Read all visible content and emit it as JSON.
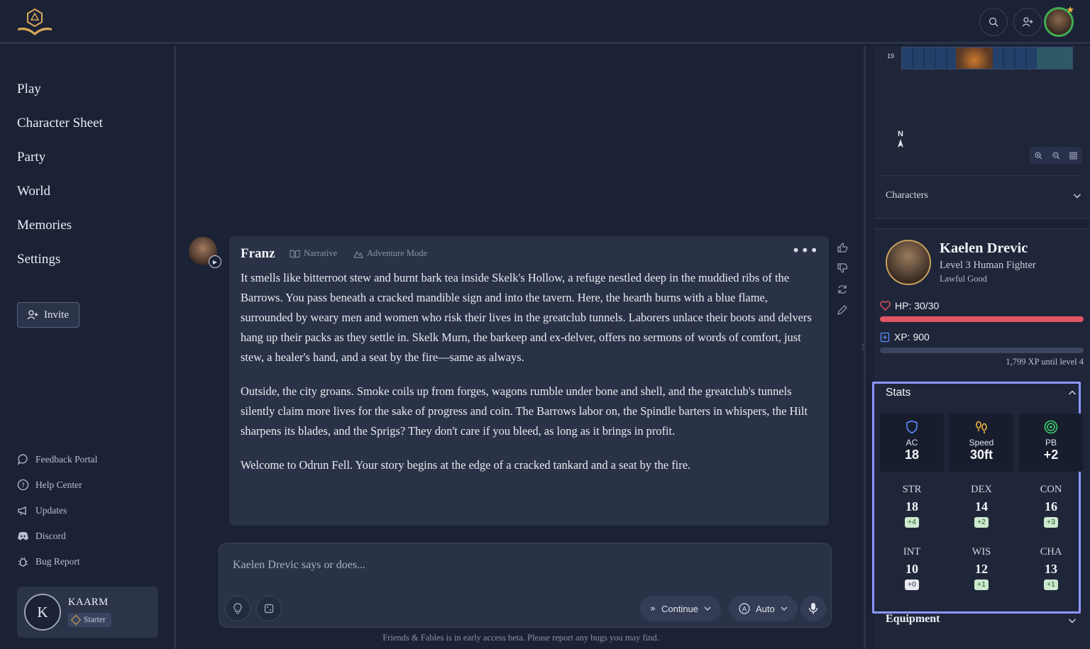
{
  "nav": {
    "items": [
      "Play",
      "Character Sheet",
      "Party",
      "World",
      "Memories",
      "Settings"
    ],
    "invite_label": "Invite",
    "links": [
      "Feedback Portal",
      "Help Center",
      "Updates",
      "Discord",
      "Bug Report"
    ]
  },
  "user": {
    "initial": "K",
    "name": "KAARM",
    "tier": "Starter"
  },
  "message": {
    "author": "Franz",
    "tag_narrative": "Narrative",
    "tag_mode": "Adventure Mode",
    "more": "•••",
    "paragraphs": [
      "It smells like bitterroot stew and burnt bark tea inside Skelk's Hollow, a refuge nestled deep in the muddied ribs of the Barrows. You pass beneath a cracked mandible sign and into the tavern. Here, the hearth burns with a blue flame, surrounded by weary men and women who risk their lives in the greatclub tunnels. Laborers unlace their boots and delvers hang up their packs as they settle in. Skelk Murn, the barkeep and ex-delver, offers no sermons of words of comfort, just stew, a healer's hand, and a seat by the fire—same as always.",
      "Outside, the city groans. Smoke coils up from forges, wagons rumble under bone and shell, and the greatclub's tunnels silently claim more lives for the sake of progress and coin. The Barrows labor on, the Spindle barters in whispers, the Hilt sharpens its blades, and the Sprigs? They don't care if you bleed, as long as it brings in profit.",
      "Welcome to Odrun Fell. Your story begins at the edge of a cracked tankard and a seat by the fire."
    ]
  },
  "composer": {
    "placeholder": "Kaelen Drevic says or does...",
    "continue_label": "Continue",
    "auto_label": "Auto"
  },
  "footer_note": "Friends & Fables is in early access beta. Please report any bugs you may find.",
  "map": {
    "row_number": "19",
    "compass": "N"
  },
  "characters_label": "Characters",
  "character": {
    "name": "Kaelen Drevic",
    "subtitle": "Level 3 Human Fighter",
    "alignment": "Lawful Good",
    "hp_label": "HP: 30/30",
    "hp_fraction": 1.0,
    "xp_label": "XP: 900",
    "xp_fraction": 0.0,
    "xp_until": "1,799 XP until level 4"
  },
  "stats": {
    "title": "Stats",
    "top": [
      {
        "label": "AC",
        "value": "18",
        "icon": "shield-icon",
        "color": "#5b8cff"
      },
      {
        "label": "Speed",
        "value": "30ft",
        "icon": "footprints-icon",
        "color": "#f2b542"
      },
      {
        "label": "PB",
        "value": "+2",
        "icon": "target-icon",
        "color": "#3fcf6a"
      }
    ],
    "abilities": [
      {
        "label": "STR",
        "value": "18",
        "mod": "+4"
      },
      {
        "label": "DEX",
        "value": "14",
        "mod": "+2"
      },
      {
        "label": "CON",
        "value": "16",
        "mod": "+3"
      },
      {
        "label": "INT",
        "value": "10",
        "mod": "+0"
      },
      {
        "label": "WIS",
        "value": "12",
        "mod": "+1"
      },
      {
        "label": "CHA",
        "value": "13",
        "mod": "+1"
      }
    ]
  },
  "equipment_label": "Equipment",
  "colors": {
    "hp_bar": "#e25563",
    "accent_border": "#8c96ff",
    "xp_icon": "#5b8cff"
  }
}
